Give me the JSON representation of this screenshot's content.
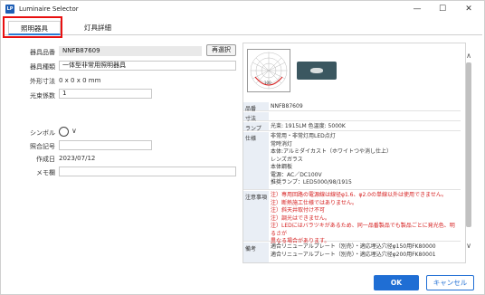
{
  "window": {
    "icon_text": "LP",
    "title": "Luminaire Selector",
    "minimize": "—",
    "maximize": "☐",
    "close": "✕"
  },
  "tabs": [
    {
      "label": "照明器具",
      "active": true
    },
    {
      "label": "灯具詳細",
      "active": false
    }
  ],
  "form": {
    "product_code": {
      "label": "器具品番",
      "value": "NNFB87609"
    },
    "reselect_button": "再選択",
    "fixture_type": {
      "label": "器具種類",
      "value": "一体型非常用照明器具"
    },
    "dimensions": {
      "label": "外形寸法",
      "value": "0 x 0 x 0 mm"
    },
    "light_coefficient": {
      "label": "光束係数",
      "value": "1"
    },
    "symbol": {
      "label": "シンボル",
      "chevron": "∨"
    },
    "reference_code": {
      "label": "照合記号",
      "value": ""
    },
    "created_date": {
      "label": "作成日",
      "value": "2023/07/12"
    },
    "memo": {
      "label": "メモ欄",
      "value": ""
    }
  },
  "detail": {
    "polar_label": "100",
    "rows": {
      "product_code": {
        "key": "品番",
        "value": "NNFB87609"
      },
      "dimensions": {
        "key": "寸法",
        "value": ""
      },
      "lamp": {
        "key": "ランプ",
        "value": "光束: 1915LM 色温度: 5000K"
      },
      "spec": {
        "key": "仕様",
        "lines": [
          "非常用・非常灯用LED点灯",
          "常時消灯",
          "本体:アルミダイカスト（ホワイトつや消し仕上）",
          "レンズガラス",
          "本体鋼板",
          "電源：AC／DC100V",
          "推奨ランプ：LED5000/98/1915"
        ]
      },
      "notes": {
        "key": "注意事項",
        "lines": [
          "注）専用回路の電源線は線径φ1.6、φ2.0の単線以外は使用できません。",
          "注）断熱施工仕様ではありません。",
          "注）斜天井取付け不可",
          "注）調光はできません。",
          "注）LEDにはバラツキがあるため、同一品番製品でも製品ごとに発光色、明るさが",
          "異なる場合があります。"
        ]
      },
      "remarks": {
        "key": "備考",
        "lines": [
          "適合リニューアルプレート（別売）・適応埋込穴径φ150用FK80000",
          "適合リニューアルプレート（別売）・適応埋込穴径φ200用FK80001"
        ]
      }
    }
  },
  "scrollbar": {
    "up": "∧",
    "down": "∨"
  },
  "buttons": {
    "ok": "OK",
    "cancel": "キャンセル"
  },
  "colors": {
    "accent": "#1f6ed4",
    "highlight": "#e81010",
    "warning_text": "#d62020"
  }
}
